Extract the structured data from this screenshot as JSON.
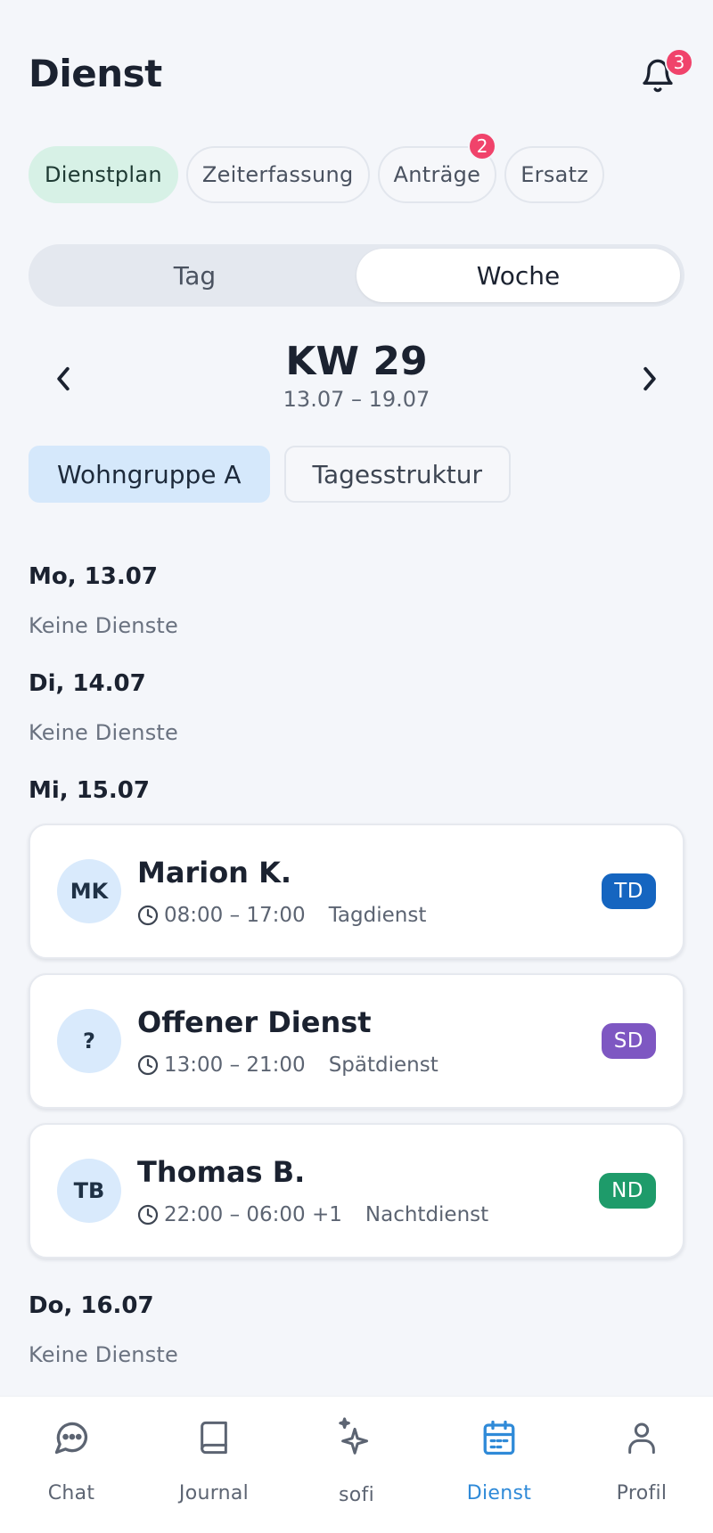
{
  "header": {
    "title": "Dienst",
    "notification_count": "3"
  },
  "tabs": [
    {
      "label": "Dienstplan",
      "active": true
    },
    {
      "label": "Zeiterfassung",
      "active": false
    },
    {
      "label": "Anträge",
      "active": false,
      "badge": "2"
    },
    {
      "label": "Ersatz",
      "active": false
    }
  ],
  "view_toggle": {
    "options": [
      "Tag",
      "Woche"
    ],
    "selected": "Woche"
  },
  "week": {
    "title": "KW 29",
    "range": "13.07 – 19.07"
  },
  "groups": [
    {
      "label": "Wohngruppe A",
      "active": true
    },
    {
      "label": "Tagesstruktur",
      "active": false
    }
  ],
  "days": [
    {
      "label": "Mo, 13.07",
      "empty_text": "Keine Dienste"
    },
    {
      "label": "Di, 14.07",
      "empty_text": "Keine Dienste"
    },
    {
      "label": "Mi, 15.07"
    },
    {
      "label": "Do, 16.07",
      "empty_text": "Keine Dienste"
    }
  ],
  "shifts": [
    {
      "initials": "MK",
      "name": "Marion K.",
      "time": "08:00 – 17:00",
      "type": "Tagdienst",
      "tag": "TD",
      "tag_color": "#1565c0"
    },
    {
      "initials": "?",
      "name": "Offener Dienst",
      "time": "13:00 – 21:00",
      "type": "Spätdienst",
      "tag": "SD",
      "tag_color": "#7e57c2"
    },
    {
      "initials": "TB",
      "name": "Thomas B.",
      "time": "22:00 – 06:00 +1",
      "type": "Nachtdienst",
      "tag": "ND",
      "tag_color": "#1e9b6a"
    }
  ],
  "bottom_nav": [
    {
      "label": "Chat",
      "icon": "chat-icon"
    },
    {
      "label": "Journal",
      "icon": "book-icon"
    },
    {
      "label": "sofi",
      "icon": "sparkle-icon"
    },
    {
      "label": "Dienst",
      "icon": "calendar-icon",
      "active": true
    },
    {
      "label": "Profil",
      "icon": "person-icon"
    }
  ],
  "colors": {
    "accent": "#2f8ad8",
    "badge": "#f0436b",
    "active_tab_bg": "#d7f1e6",
    "active_group_bg": "#d5e8fb"
  }
}
